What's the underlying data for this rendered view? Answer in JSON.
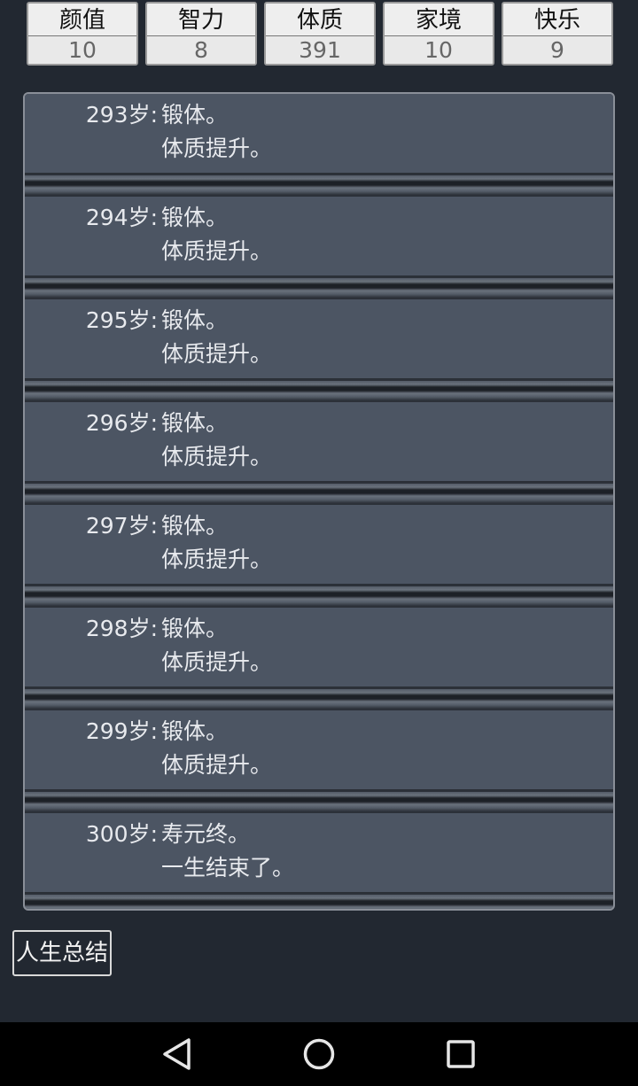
{
  "stats": [
    {
      "label": "颜值",
      "value": "10"
    },
    {
      "label": "智力",
      "value": "8"
    },
    {
      "label": "体质",
      "value": "391"
    },
    {
      "label": "家境",
      "value": "10"
    },
    {
      "label": "快乐",
      "value": "9"
    }
  ],
  "log": [
    {
      "age": "293岁:",
      "lines": [
        "锻体。",
        "体质提升。"
      ]
    },
    {
      "age": "294岁:",
      "lines": [
        "锻体。",
        "体质提升。"
      ]
    },
    {
      "age": "295岁:",
      "lines": [
        "锻体。",
        "体质提升。"
      ]
    },
    {
      "age": "296岁:",
      "lines": [
        "锻体。",
        "体质提升。"
      ]
    },
    {
      "age": "297岁:",
      "lines": [
        "锻体。",
        "体质提升。"
      ]
    },
    {
      "age": "298岁:",
      "lines": [
        "锻体。",
        "体质提升。"
      ]
    },
    {
      "age": "299岁:",
      "lines": [
        "锻体。",
        "体质提升。"
      ]
    },
    {
      "age": "300岁:",
      "lines": [
        "寿元终。",
        "一生结束了。"
      ]
    }
  ],
  "summary_button": {
    "label": "人生总结"
  },
  "navbar": {
    "back_icon": "back-triangle-icon",
    "home_icon": "home-circle-icon",
    "recents_icon": "recents-square-icon"
  }
}
